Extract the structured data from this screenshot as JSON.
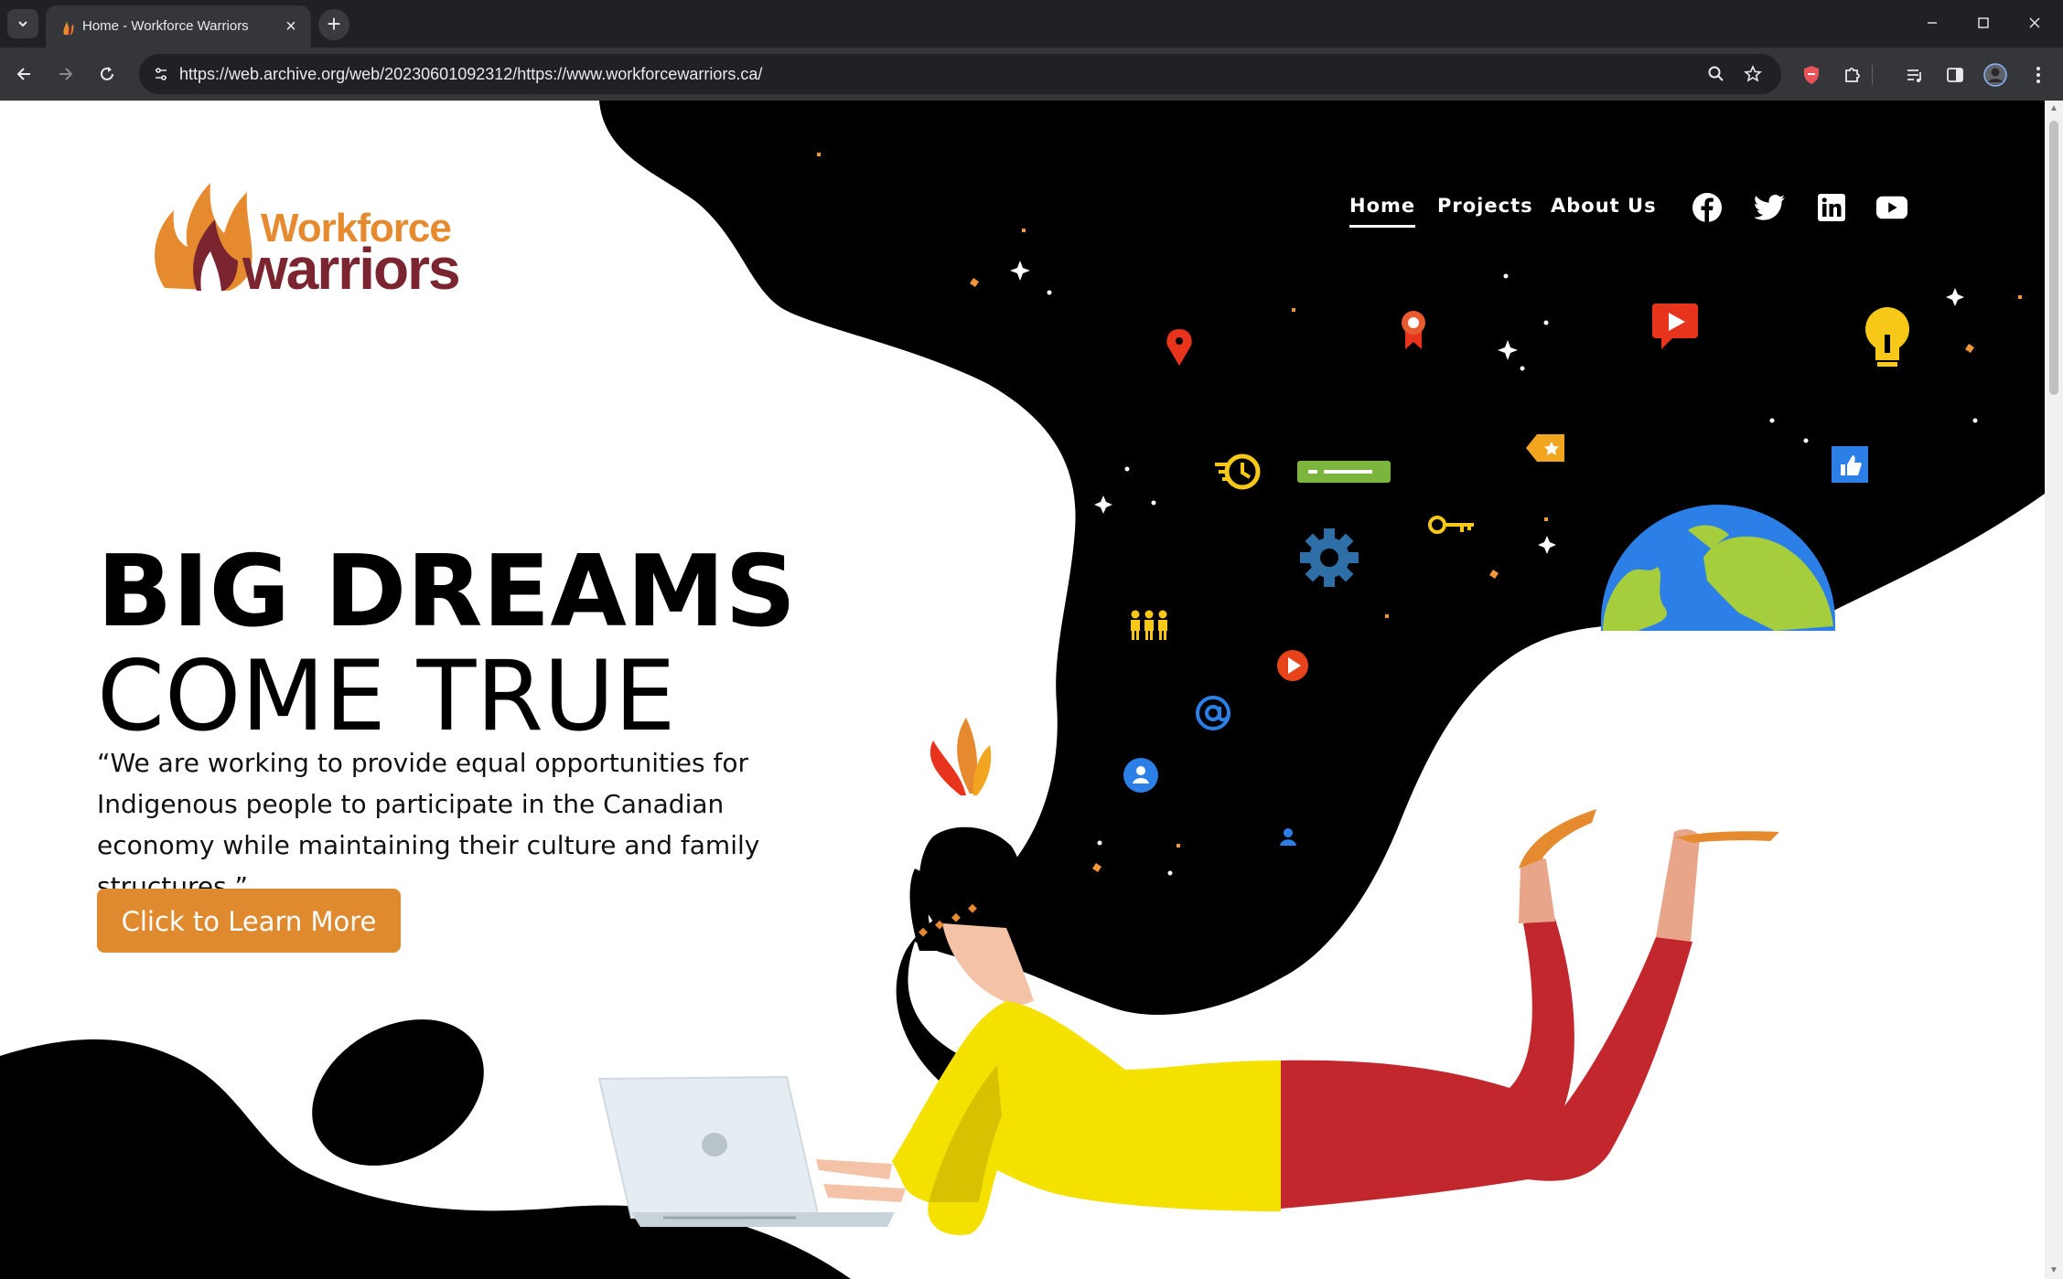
{
  "browser": {
    "tab": {
      "title": "Home - Workforce Warriors"
    },
    "address_bar": {
      "url": "https://web.archive.org/web/20230601092312/https://www.workforcewarriors.ca/"
    }
  },
  "site": {
    "logo": {
      "line1": "Workforce",
      "line2": "warriors"
    },
    "nav": [
      {
        "label": "Home",
        "active": true
      },
      {
        "label": "Projects",
        "active": false
      },
      {
        "label": "About Us",
        "active": false
      }
    ],
    "social": [
      "facebook-icon",
      "twitter-icon",
      "linkedin-icon",
      "youtube-icon"
    ]
  },
  "hero": {
    "title_line1": "BIG DREAMS",
    "title_line2": "COME TRUE",
    "quote": "“We are working to provide equal opportunities for Indigenous people to participate in the Canadian economy while maintaining their culture and family structures.”",
    "cta_label": "Click to Learn More"
  },
  "colors": {
    "brand_orange": "#e08a2f",
    "brand_maroon": "#7a2530",
    "hair_black": "#000000",
    "shirt_yellow": "#f4e100",
    "pants_red": "#c1272d"
  }
}
